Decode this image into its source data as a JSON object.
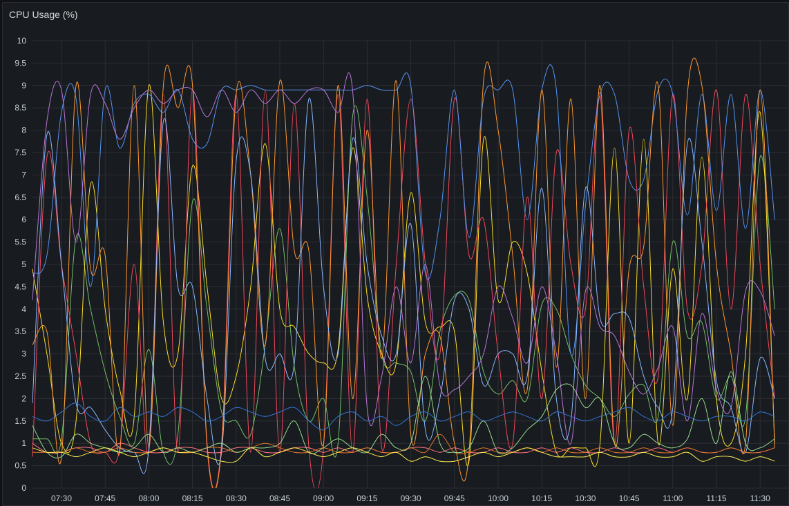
{
  "panel": {
    "title": "CPU Usage (%)"
  },
  "colors": {
    "background": "#181b1f",
    "grid": "#2c2e33",
    "text": "#c7d0d9"
  },
  "chart_data": {
    "type": "line",
    "title": "CPU Usage (%)",
    "xlabel": "",
    "ylabel": "",
    "ylim": [
      0,
      10
    ],
    "yticks": [
      "0",
      "0.5",
      "1",
      "1.5",
      "2",
      "2.5",
      "3",
      "3.5",
      "4",
      "4.5",
      "5",
      "5.5",
      "6",
      "6.5",
      "7",
      "7.5",
      "8",
      "8.5",
      "9",
      "9.5",
      "10"
    ],
    "xticks": [
      "07:30",
      "07:45",
      "08:00",
      "08:15",
      "08:30",
      "08:45",
      "09:00",
      "09:15",
      "09:30",
      "09:45",
      "10:00",
      "10:15",
      "10:30",
      "10:45",
      "11:00",
      "11:15",
      "11:30"
    ],
    "x": [
      "07:20",
      "07:25",
      "07:30",
      "07:35",
      "07:40",
      "07:45",
      "07:50",
      "07:55",
      "08:00",
      "08:05",
      "08:10",
      "08:15",
      "08:20",
      "08:25",
      "08:30",
      "08:35",
      "08:40",
      "08:45",
      "08:50",
      "08:55",
      "09:00",
      "09:05",
      "09:10",
      "09:15",
      "09:20",
      "09:25",
      "09:30",
      "09:35",
      "09:40",
      "09:45",
      "09:50",
      "09:55",
      "10:00",
      "10:05",
      "10:10",
      "10:15",
      "10:20",
      "10:25",
      "10:30",
      "10:35",
      "10:40",
      "10:45",
      "10:50",
      "10:55",
      "11:00",
      "11:05",
      "11:10",
      "11:15",
      "11:20",
      "11:25",
      "11:30",
      "11:35"
    ],
    "grid": true,
    "legend": "none",
    "series": [
      {
        "color": "#73bf69",
        "values": [
          1.1,
          1.1,
          1.1,
          5.6,
          4.0,
          2.6,
          1.6,
          1.0,
          3.1,
          0.8,
          1.2,
          6.4,
          4.0,
          1.7,
          1.5,
          1.2,
          3.2,
          5.8,
          2.7,
          1.5,
          2.0,
          1.0,
          8.3,
          6.5,
          3.0,
          2.8,
          2.6,
          1.5,
          3.5,
          4.3,
          4.2,
          2.6,
          2.1,
          2.4,
          2.0,
          4.1,
          4.0,
          3.0,
          2.3,
          2.0,
          1.6,
          2.1,
          2.3,
          1.6,
          5.5,
          3.4,
          3.7,
          2.0,
          2.5,
          1.6,
          7.4,
          4.0
        ]
      },
      {
        "color": "#fade2a",
        "values": [
          4.9,
          3.0,
          1.0,
          1.5,
          6.8,
          4.0,
          2.2,
          1.6,
          9.0,
          3.7,
          3.0,
          7.2,
          4.5,
          2.0,
          2.5,
          4.5,
          7.7,
          4.0,
          3.6,
          3.0,
          2.8,
          3.1,
          7.6,
          4.3,
          3.0,
          2.8,
          6.6,
          3.7,
          3.6,
          3.5,
          0.6,
          7.8,
          4.2,
          5.5,
          4.8,
          2.6,
          0.8,
          0.9,
          0.9,
          1.0,
          7.6,
          1.0,
          7.8,
          1.0,
          4.9,
          2.0,
          7.4,
          2.0,
          1.0,
          3.0,
          8.4,
          1.0
        ]
      },
      {
        "color": "#f2495c",
        "values": [
          0.7,
          7.4,
          5.0,
          3.0,
          1.0,
          0.8,
          0.9,
          5.0,
          0.8,
          8.8,
          0.8,
          8.9,
          0.9,
          1.0,
          8.8,
          0.8,
          8.9,
          0.8,
          8.6,
          0.9,
          0.9,
          8.8,
          0.8,
          8.7,
          0.9,
          5.0,
          8.7,
          5.0,
          3.0,
          8.7,
          5.2,
          6.0,
          3.0,
          1.0,
          6.5,
          2.0,
          7.5,
          5.0,
          4.0,
          8.8,
          1.0,
          8.0,
          4.5,
          2.5,
          8.8,
          4.0,
          5.0,
          8.9,
          4.0,
          8.8,
          5.0,
          2.0
        ]
      },
      {
        "color": "#5794f2",
        "values": [
          4.8,
          5.2,
          8.4,
          8.7,
          4.5,
          8.9,
          7.6,
          8.6,
          8.8,
          8.4,
          8.9,
          7.8,
          7.7,
          8.9,
          8.9,
          9.0,
          8.9,
          8.9,
          8.9,
          8.9,
          8.9,
          8.9,
          8.9,
          9.0,
          8.9,
          8.9,
          9.0,
          4.8,
          6.0,
          8.9,
          5.6,
          8.7,
          8.9,
          8.9,
          6.0,
          8.9,
          8.9,
          3.0,
          6.3,
          8.8,
          8.8,
          6.9,
          6.9,
          8.9,
          8.8,
          6.1,
          8.8,
          6.2,
          8.8,
          5.8,
          8.9,
          6.0
        ]
      },
      {
        "color": "#ff9830",
        "values": [
          3.2,
          3.5,
          0.7,
          9.0,
          4.9,
          5.2,
          0.8,
          9.0,
          0.9,
          9.0,
          8.5,
          9.0,
          1.0,
          0.9,
          8.8,
          7.0,
          3.2,
          9.1,
          5.3,
          5.3,
          1.0,
          9.0,
          2.0,
          8.0,
          2.9,
          9.1,
          1.2,
          3.0,
          3.4,
          1.0,
          0.8,
          9.1,
          8.0,
          5.2,
          2.2,
          8.9,
          2.7,
          8.7,
          2.0,
          9.0,
          1.0,
          4.9,
          5.4,
          9.0,
          1.4,
          8.8,
          9.0,
          5.0,
          3.0,
          1.0,
          8.9,
          0.9
        ]
      },
      {
        "color": "#b877d9",
        "values": [
          4.2,
          8.2,
          8.9,
          5.5,
          8.8,
          8.6,
          7.8,
          8.5,
          8.9,
          8.6,
          8.9,
          8.9,
          8.3,
          8.9,
          8.4,
          8.9,
          8.6,
          8.9,
          8.6,
          8.9,
          8.9,
          8.4,
          8.9,
          1.8,
          2.5,
          4.5,
          2.8,
          5.0,
          2.3,
          2.2,
          2.5,
          3.0,
          4.5,
          3.8,
          2.8,
          4.5,
          3.0,
          1.0,
          4.4,
          3.6,
          3.4,
          2.6,
          2.1,
          2.7,
          3.6,
          1.5,
          3.9,
          2.2,
          1.8,
          4.4,
          4.4,
          3.4
        ]
      },
      {
        "color": "#8ab8ff",
        "values": [
          1.9,
          7.9,
          5.0,
          1.9,
          1.8,
          1.3,
          0.9,
          0.8,
          0.9,
          8.2,
          4.5,
          4.5,
          2.0,
          0.8,
          7.3,
          7.0,
          2.9,
          3.0,
          2.8,
          8.7,
          4.5,
          3.0,
          7.8,
          5.0,
          3.4,
          3.0,
          5.9,
          1.3,
          2.0,
          4.2,
          4.0,
          2.3,
          3.0,
          3.0,
          2.5,
          6.7,
          2.0,
          1.5,
          6.7,
          3.8,
          3.9,
          3.8,
          2.5,
          1.8,
          1.8,
          7.7,
          5.5,
          2.4,
          1.8,
          0.8,
          2.9,
          2.0
        ]
      },
      {
        "color": "#3274d9",
        "values": [
          1.6,
          1.5,
          1.7,
          1.9,
          1.6,
          1.5,
          1.8,
          1.6,
          1.7,
          1.6,
          1.8,
          1.7,
          1.5,
          1.6,
          1.8,
          1.7,
          1.6,
          1.7,
          1.8,
          1.5,
          1.3,
          1.6,
          1.7,
          1.5,
          1.6,
          1.4,
          1.6,
          1.7,
          1.5,
          1.6,
          1.7,
          1.5,
          1.6,
          1.7,
          1.6,
          1.5,
          1.7,
          1.6,
          1.5,
          1.6,
          1.7,
          1.8,
          1.6,
          1.5,
          1.7,
          1.6,
          1.5,
          1.6,
          1.6,
          1.5,
          1.7,
          1.6
        ]
      },
      {
        "color": "#ff7383",
        "values": [
          1.0,
          0.8,
          0.8,
          0.9,
          0.9,
          0.8,
          1.0,
          0.9,
          0.8,
          0.8,
          0.9,
          0.9,
          0.8,
          0.8,
          0.9,
          0.9,
          0.8,
          0.8,
          0.9,
          0.9,
          0.8,
          0.9,
          0.8,
          0.9,
          0.8,
          0.8,
          0.9,
          0.9,
          0.8,
          0.9,
          0.8,
          0.8,
          0.9,
          0.8,
          0.8,
          0.9,
          0.8,
          0.9,
          0.8,
          0.8,
          0.9,
          0.8,
          0.8,
          0.9,
          0.8,
          0.9,
          0.8,
          0.8,
          0.9,
          0.8,
          0.8,
          0.9
        ]
      },
      {
        "color": "#e0752d",
        "values": [
          0.8,
          0.8,
          0.8,
          0.9,
          0.8,
          0.8,
          0.9,
          0.8,
          0.8,
          0.9,
          0.8,
          0.8,
          0.9,
          0.9,
          0.8,
          0.9,
          1.0,
          0.9,
          0.8,
          0.8,
          0.9,
          0.8,
          0.8,
          0.9,
          0.8,
          0.8,
          0.9,
          0.8,
          1.2,
          0.8,
          0.8,
          0.9,
          0.8,
          0.8,
          0.9,
          0.8,
          0.9,
          0.8,
          0.8,
          0.9,
          0.8,
          0.8,
          0.9,
          0.8,
          0.8,
          0.9,
          0.8,
          0.8,
          0.9,
          0.8,
          0.8,
          0.9
        ]
      },
      {
        "color": "#96d98d",
        "values": [
          1.4,
          0.8,
          0.7,
          1.2,
          1.0,
          0.9,
          0.8,
          0.9,
          1.2,
          0.8,
          0.9,
          0.8,
          0.9,
          1.0,
          0.8,
          0.9,
          0.9,
          1.0,
          1.5,
          0.8,
          0.9,
          1.1,
          0.9,
          0.8,
          1.2,
          0.9,
          1.0,
          2.5,
          1.0,
          0.8,
          0.9,
          1.5,
          0.8,
          0.9,
          1.3,
          1.6,
          2.2,
          2.3,
          1.8,
          2.0,
          1.0,
          0.9,
          1.2,
          1.0,
          0.9,
          1.1,
          2.0,
          1.0,
          2.6,
          1.0,
          0.9,
          1.1
        ]
      },
      {
        "color": "#ffee52",
        "values": [
          0.9,
          0.8,
          0.8,
          0.7,
          0.8,
          0.9,
          0.8,
          0.7,
          0.8,
          0.9,
          0.8,
          0.8,
          0.7,
          0.6,
          0.6,
          0.9,
          0.7,
          0.8,
          0.9,
          0.8,
          0.7,
          0.8,
          0.9,
          0.8,
          0.7,
          0.8,
          0.6,
          0.7,
          0.6,
          0.6,
          0.7,
          0.8,
          0.7,
          0.8,
          0.9,
          0.8,
          0.7,
          0.7,
          0.7,
          0.8,
          0.7,
          0.7,
          0.8,
          0.7,
          0.7,
          0.8,
          0.6,
          0.7,
          0.7,
          0.6,
          0.7,
          0.6
        ]
      }
    ]
  }
}
